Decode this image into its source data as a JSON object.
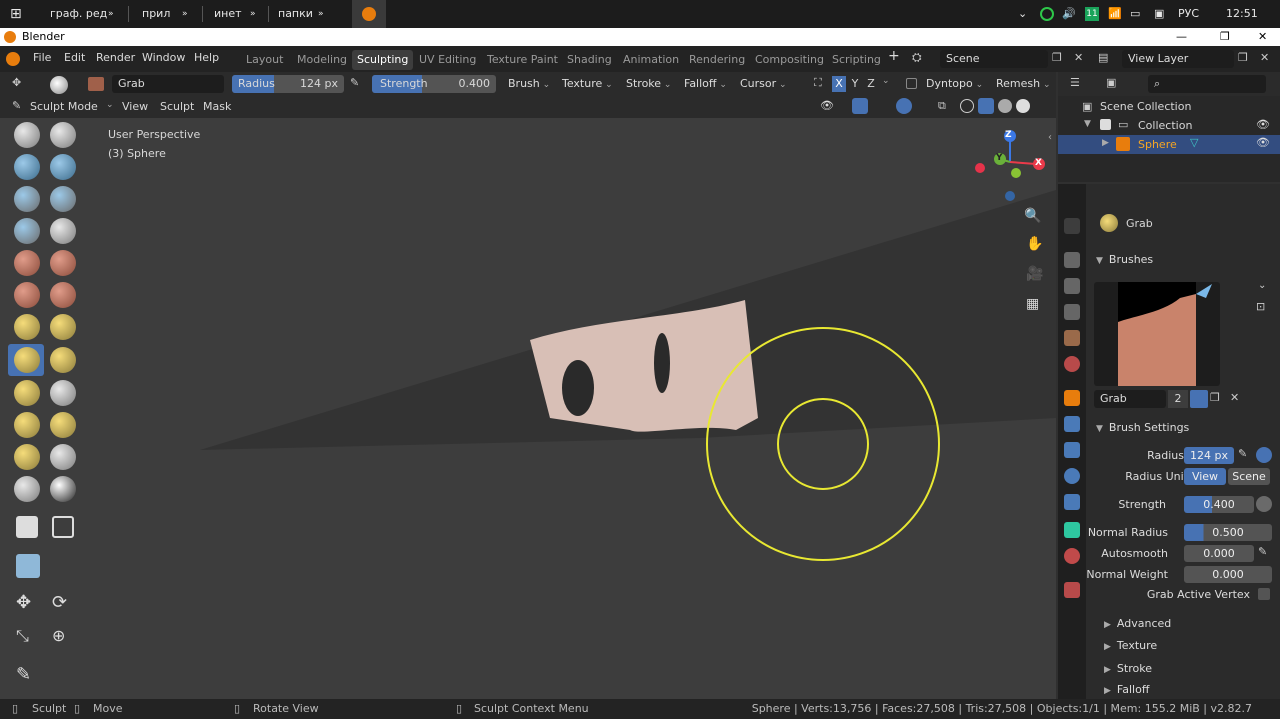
{
  "taskbar": {
    "items": [
      "граф. ред",
      "прил",
      "инет",
      "папки"
    ],
    "lang": "РУС",
    "time": "12:51",
    "badge": "11"
  },
  "window": {
    "title": "Blender"
  },
  "menu": [
    "File",
    "Edit",
    "Render",
    "Window",
    "Help"
  ],
  "workspaces": [
    "Layout",
    "Modeling",
    "Sculpting",
    "UV Editing",
    "Texture Paint",
    "Shading",
    "Animation",
    "Rendering",
    "Compositing",
    "Scripting"
  ],
  "scene": {
    "label": "Scene",
    "view_layer": "View Layer"
  },
  "tool_header": {
    "brush": "Grab",
    "radius_label": "Radius",
    "radius_val": "124 px",
    "strength_label": "Strength",
    "strength_val": "0.400",
    "menus": [
      "Brush",
      "Texture",
      "Stroke",
      "Falloff",
      "Cursor"
    ],
    "axes": [
      "X",
      "Y",
      "Z"
    ],
    "dyntopo": "Dyntopo",
    "remesh": "Remesh"
  },
  "mode_header": {
    "mode": "Sculpt Mode",
    "menus": [
      "View",
      "Sculpt",
      "Mask"
    ]
  },
  "viewport": {
    "overlay1": "User Perspective",
    "overlay2": "(3) Sphere",
    "gizmo": {
      "z": "Z",
      "y": "Y",
      "x": "X"
    }
  },
  "outliner": {
    "scene_collection": "Scene Collection",
    "collection": "Collection",
    "object": "Sphere"
  },
  "properties": {
    "brush_name": "Grab",
    "brushes_section": "Brushes",
    "brush_slot": "Grab",
    "users": "2",
    "brush_settings": "Brush Settings",
    "radius_label": "Radius",
    "radius_val": "124 px",
    "radius_unit_label": "Radius Unit",
    "unit_view": "View",
    "unit_scene": "Scene",
    "strength_label": "Strength",
    "strength_val": "0.400",
    "normal_radius_label": "Normal Radius",
    "normal_radius_val": "0.500",
    "autosmooth_label": "Autosmooth",
    "autosmooth_val": "0.000",
    "normal_weight_label": "Normal Weight",
    "normal_weight_val": "0.000",
    "grab_active_label": "Grab Active Vertex",
    "subpanels": [
      "Advanced",
      "Texture",
      "Stroke",
      "Falloff"
    ]
  },
  "statusbar": {
    "sculpt": "Sculpt",
    "move": "Move",
    "rotate": "Rotate View",
    "context": "Sculpt Context Menu",
    "stats": "Sphere | Verts:13,756 | Faces:27,508 | Tris:27,508 | Objects:1/1 | Mem: 155.2 MiB | v2.82.7"
  },
  "colors": {
    "accent": "#4772b3",
    "active_obj": "#f5a623",
    "cursor": "#e8e832"
  }
}
